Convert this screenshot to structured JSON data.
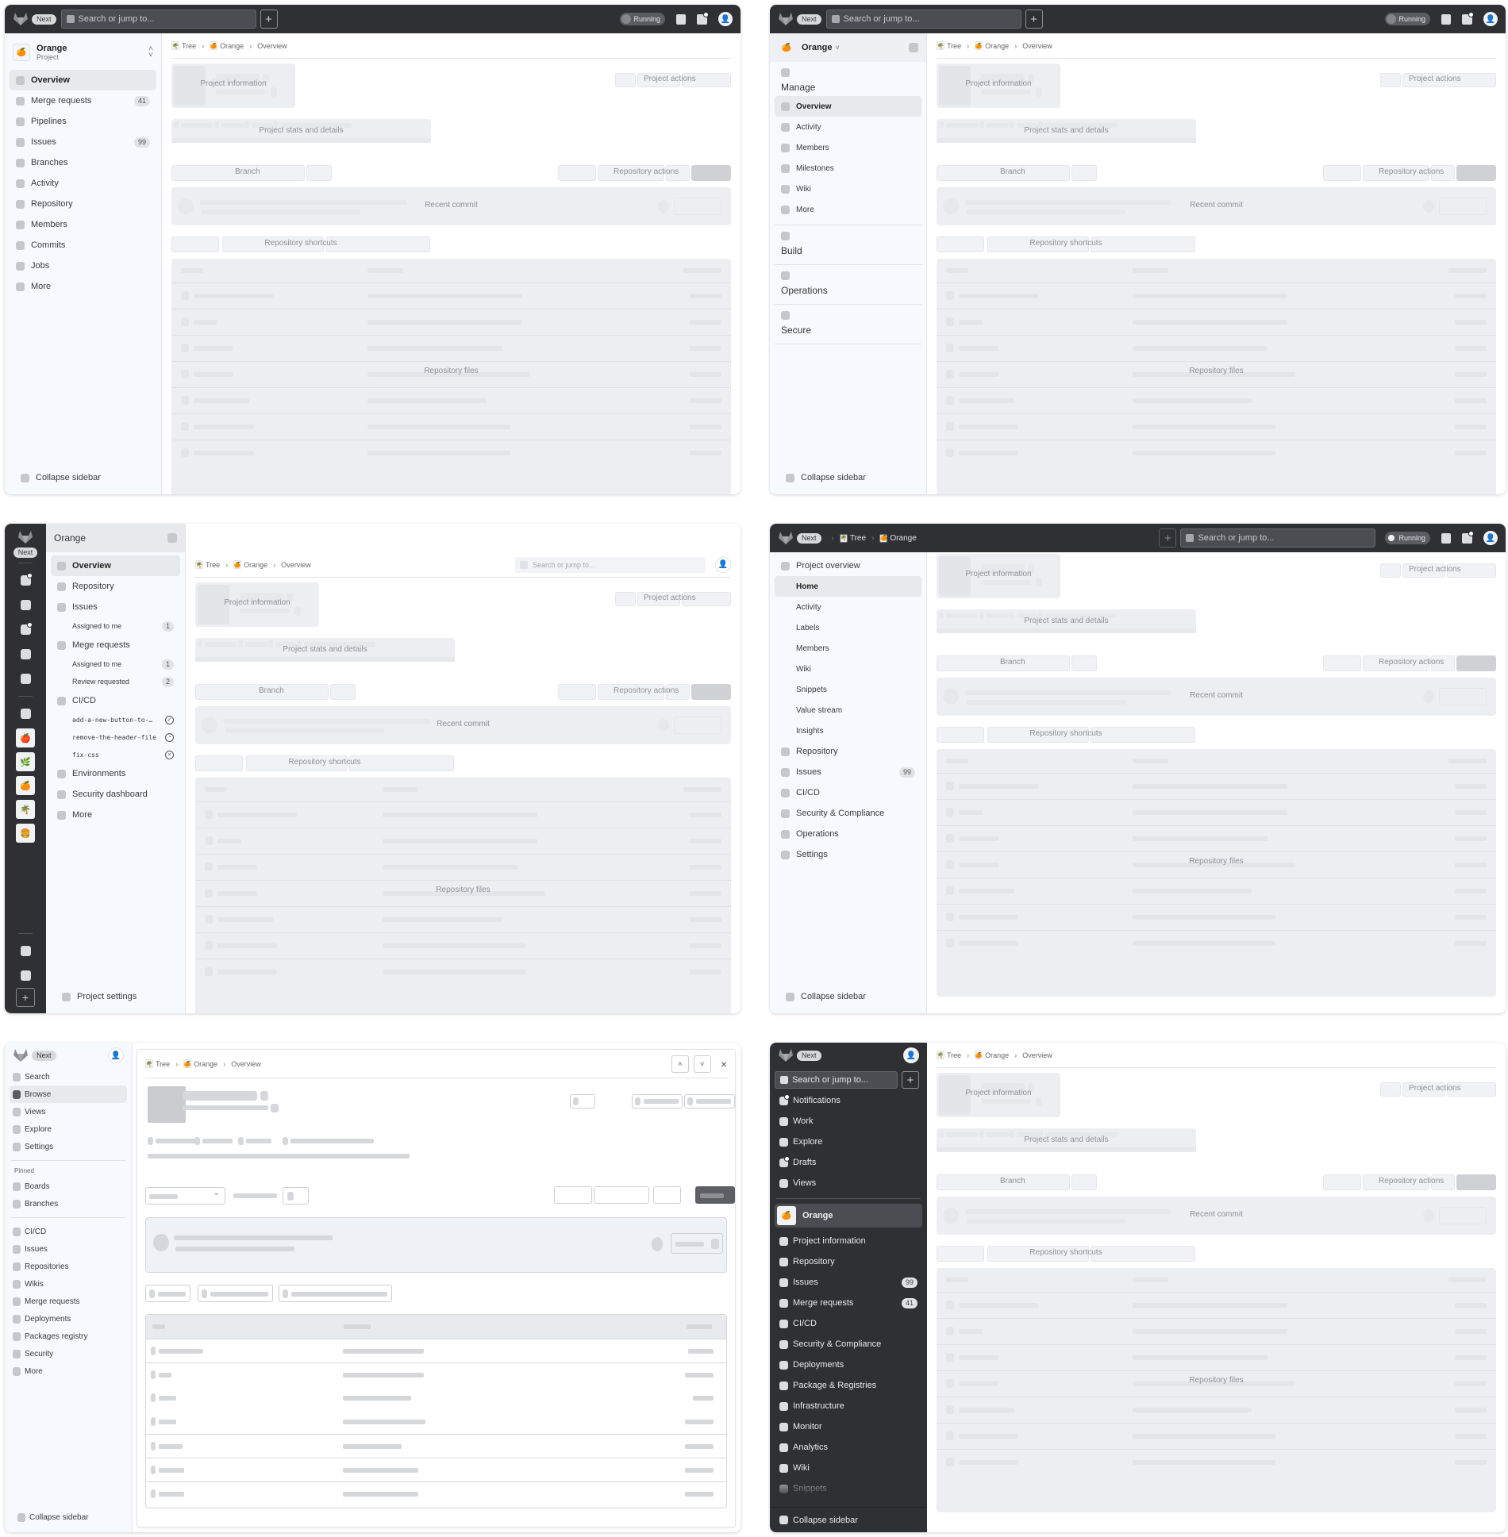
{
  "common": {
    "next_badge": "Next",
    "search_placeholder": "Search or jump to...",
    "plus": "+",
    "running": "Running",
    "breadcrumb": [
      {
        "label": "Tree",
        "icon": "palm-tree-icon"
      },
      {
        "label": "Orange",
        "icon": "orange-icon"
      },
      {
        "label": "Overview"
      }
    ],
    "separator": "›",
    "placeholders": {
      "project_information": "Project information",
      "project_actions": "Project actions",
      "project_stats": "Project stats and details",
      "branch": "Branch",
      "repository_actions": "Repository actions",
      "recent_commit": "Recent commit",
      "repository_shortcuts": "Repository shortcuts",
      "repository_files": "Repository files"
    },
    "collapse_sidebar": "Collapse sidebar"
  },
  "panel1": {
    "project": {
      "name": "Orange",
      "type": "Project"
    },
    "nav": [
      {
        "label": "Overview",
        "active": true
      },
      {
        "label": "Merge requests",
        "badge": "41"
      },
      {
        "label": "Pipelines"
      },
      {
        "label": "Issues",
        "badge": "99"
      },
      {
        "label": "Branches"
      },
      {
        "label": "Activity"
      },
      {
        "label": "Repository"
      },
      {
        "label": "Members"
      },
      {
        "label": "Commits"
      },
      {
        "label": "Jobs"
      },
      {
        "label": "More"
      }
    ]
  },
  "panel2": {
    "project": {
      "name": "Orange"
    },
    "sections": [
      {
        "title": "Manage",
        "items": [
          "Overview",
          "Activity",
          "Members",
          "Milestones",
          "Wiki",
          "More"
        ],
        "active": "Overview"
      },
      {
        "title": "Build"
      },
      {
        "title": "Operations"
      },
      {
        "title": "Secure"
      }
    ]
  },
  "panel3": {
    "project": {
      "name": "Orange"
    },
    "nav": [
      {
        "label": "Overview",
        "active": true
      },
      {
        "label": "Repository"
      },
      {
        "label": "Issues"
      },
      {
        "label": "Assigned to me",
        "sub": true,
        "badge": "1"
      },
      {
        "label": "Mege requests"
      },
      {
        "label": "Assigned to me",
        "sub": true,
        "badge": "1"
      },
      {
        "label": "Review requested",
        "sub": true,
        "badge": "2"
      },
      {
        "label": "CI/CD"
      },
      {
        "label": "add-a-new-button-to-…",
        "sub": true,
        "mono": true,
        "status": "passed"
      },
      {
        "label": "remove-the-header-file",
        "sub": true,
        "mono": true,
        "status": "running"
      },
      {
        "label": "fix-css",
        "sub": true,
        "mono": true,
        "status": "failed"
      },
      {
        "label": "Environments"
      },
      {
        "label": "Security dashboard"
      },
      {
        "label": "More"
      }
    ],
    "project_settings": "Project settings",
    "rail_projects": [
      "apple-icon",
      "plant-icon",
      "orange-icon",
      "palm-tree-icon",
      "burger-icon"
    ]
  },
  "panel4": {
    "topbar_crumbs": [
      {
        "label": "Tree",
        "icon": "palm-tree-icon"
      },
      {
        "label": "Orange",
        "icon": "orange-icon"
      }
    ],
    "nav": [
      {
        "label": "Project overview",
        "icon": true
      },
      {
        "label": "Home",
        "sub": true,
        "active": true
      },
      {
        "label": "Activity",
        "sub": true
      },
      {
        "label": "Labels",
        "sub": true
      },
      {
        "label": "Members",
        "sub": true
      },
      {
        "label": "Wiki",
        "sub": true
      },
      {
        "label": "Snippets",
        "sub": true
      },
      {
        "label": "Value stream",
        "sub": true
      },
      {
        "label": "Insights",
        "sub": true
      },
      {
        "label": "Repository",
        "icon": true
      },
      {
        "label": "Issues",
        "icon": true,
        "badge": "99"
      },
      {
        "label": "CI/CD",
        "icon": true
      },
      {
        "label": "Security & Compliance",
        "icon": true
      },
      {
        "label": "Operations",
        "icon": true
      },
      {
        "label": "Settings",
        "icon": true
      }
    ]
  },
  "panel5": {
    "nav_top": [
      {
        "label": "Search"
      },
      {
        "label": "Browse",
        "active": true
      },
      {
        "label": "Views"
      },
      {
        "label": "Explore"
      },
      {
        "label": "Settings"
      }
    ],
    "pinned_label": "Pinned",
    "pinned": [
      {
        "label": "Boards"
      },
      {
        "label": "Branches"
      }
    ],
    "nav_bottom": [
      {
        "label": "CI/CD"
      },
      {
        "label": "Issues"
      },
      {
        "label": "Repositories"
      },
      {
        "label": "Wikis"
      },
      {
        "label": "Merge requests"
      },
      {
        "label": "Deployments"
      },
      {
        "label": "Packages registry"
      },
      {
        "label": "Security"
      },
      {
        "label": "More"
      }
    ],
    "close": "×",
    "up": "˄",
    "down": "˅"
  },
  "panel6": {
    "nav_global": [
      {
        "label": "Notifications",
        "notif": true
      },
      {
        "label": "Work"
      },
      {
        "label": "Explore"
      },
      {
        "label": "Drafts",
        "notif": true
      },
      {
        "label": "Views"
      }
    ],
    "project": {
      "name": "Orange"
    },
    "nav_project": [
      {
        "label": "Project information"
      },
      {
        "label": "Repository"
      },
      {
        "label": "Issues",
        "badge": "99"
      },
      {
        "label": "Merge requests",
        "badge": "41"
      },
      {
        "label": "CI/CD"
      },
      {
        "label": "Security & Compliance"
      },
      {
        "label": "Deployments"
      },
      {
        "label": "Package & Registries"
      },
      {
        "label": "Infrastructure"
      },
      {
        "label": "Monitor"
      },
      {
        "label": "Analytics"
      },
      {
        "label": "Wiki"
      },
      {
        "label": "Snippets"
      }
    ]
  }
}
